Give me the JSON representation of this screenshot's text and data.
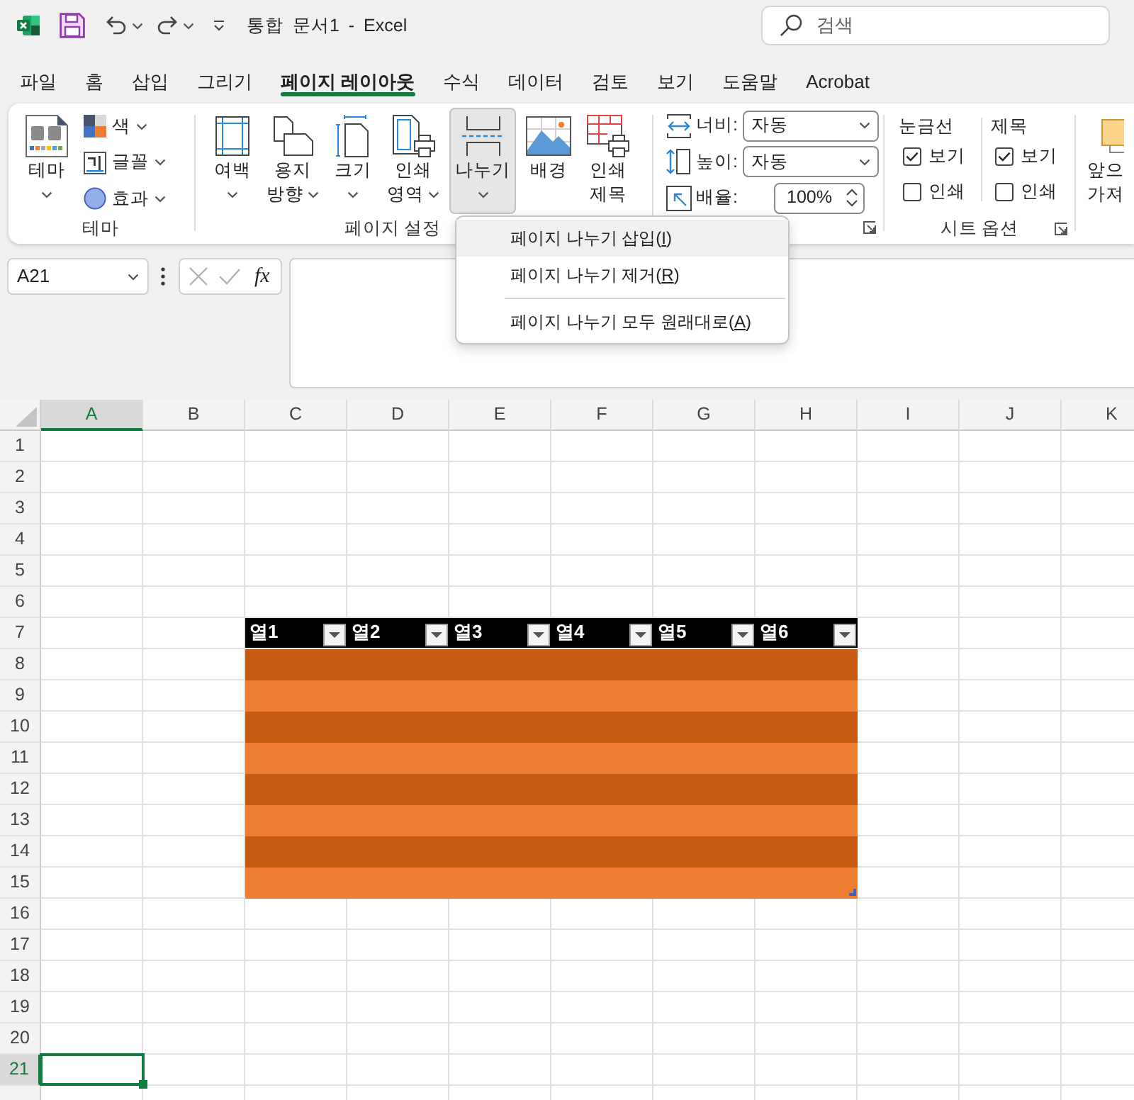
{
  "title_bar": {
    "document_title": "통합 문서1 - Excel",
    "search": {
      "placeholder": "검색"
    }
  },
  "ribbon_tabs": [
    {
      "label": "파일",
      "selected": false
    },
    {
      "label": "홈",
      "selected": false
    },
    {
      "label": "삽입",
      "selected": false
    },
    {
      "label": "그리기",
      "selected": false
    },
    {
      "label": "페이지 레이아웃",
      "selected": true
    },
    {
      "label": "수식",
      "selected": false
    },
    {
      "label": "데이터",
      "selected": false
    },
    {
      "label": "검토",
      "selected": false
    },
    {
      "label": "보기",
      "selected": false
    },
    {
      "label": "도움말",
      "selected": false
    },
    {
      "label": "Acrobat",
      "selected": false
    }
  ],
  "ribbon": {
    "groups": [
      {
        "kind": "themes",
        "label": "테마",
        "dialog_launcher": false,
        "large_buttons": [
          {
            "kind": "theme",
            "label_lines": [
              "테마"
            ],
            "dropdown": true,
            "pressed": false
          }
        ],
        "small_buttons": [
          {
            "kind": "colors",
            "label": "색",
            "dropdown": true
          },
          {
            "kind": "fonts",
            "label": "글꼴",
            "dropdown": true
          },
          {
            "kind": "effects",
            "label": "효과",
            "dropdown": true
          }
        ]
      },
      {
        "kind": "page_setup",
        "label": "페이지 설정",
        "dialog_launcher": false,
        "large_buttons": [
          {
            "kind": "margins",
            "label_lines": [
              "여백"
            ],
            "dropdown": true,
            "pressed": false
          },
          {
            "kind": "orientation",
            "label_lines": [
              "용지",
              "방향"
            ],
            "dropdown": true,
            "pressed": false
          },
          {
            "kind": "size",
            "label_lines": [
              "크기"
            ],
            "dropdown": true,
            "pressed": false
          },
          {
            "kind": "print_area",
            "label_lines": [
              "인쇄",
              "영역"
            ],
            "dropdown": true,
            "pressed": false
          },
          {
            "kind": "breaks",
            "label_lines": [
              "나누기"
            ],
            "dropdown": true,
            "pressed": true
          },
          {
            "kind": "background",
            "label_lines": [
              "배경"
            ],
            "dropdown": false,
            "pressed": false
          },
          {
            "kind": "print_titles",
            "label_lines": [
              "인쇄",
              "제목"
            ],
            "dropdown": false,
            "pressed": false
          }
        ]
      },
      {
        "kind": "scale_to_fit",
        "dialog_launcher": true,
        "fields": [
          {
            "kind": "width",
            "label": "너비:",
            "value": "자동"
          },
          {
            "kind": "height",
            "label": "높이:",
            "value": "자동"
          },
          {
            "kind": "scale",
            "label": "배율:",
            "value": "100%"
          }
        ]
      },
      {
        "kind": "sheet_options",
        "label": "시트 옵션",
        "dialog_launcher": true,
        "option_columns": [
          {
            "heading": "눈금선",
            "options": [
              {
                "label": "보기",
                "checked": true
              },
              {
                "label": "인쇄",
                "checked": false
              }
            ]
          },
          {
            "heading": "제목",
            "options": [
              {
                "label": "보기",
                "checked": true
              },
              {
                "label": "인쇄",
                "checked": false
              }
            ]
          }
        ]
      },
      {
        "kind": "arrange",
        "large_buttons": [
          {
            "kind": "bring_forward",
            "label_lines": [
              "앞으",
              "가져"
            ],
            "dropdown": false,
            "pressed": false
          }
        ]
      }
    ]
  },
  "breaks_menu": {
    "items": [
      {
        "text": "페이지 나누기 삽입(",
        "access_key": "I",
        "text_end": ")",
        "selected": true,
        "divider_above": false
      },
      {
        "text": "페이지 나누기 제거(",
        "access_key": "R",
        "text_end": ")",
        "selected": false,
        "divider_above": false
      },
      {
        "text": "페이지 나누기 모두 원래대로(",
        "access_key": "A",
        "text_end": ")",
        "selected": false,
        "divider_above": true
      }
    ]
  },
  "formula_bar": {
    "name_box": "A21",
    "function_button": "fx"
  },
  "sheet": {
    "columns": [
      {
        "label": "A",
        "selected": true,
        "in_table": false
      },
      {
        "label": "B",
        "selected": false,
        "in_table": false
      },
      {
        "label": "C",
        "selected": false,
        "in_table": true
      },
      {
        "label": "D",
        "selected": false,
        "in_table": true
      },
      {
        "label": "E",
        "selected": false,
        "in_table": true
      },
      {
        "label": "F",
        "selected": false,
        "in_table": true
      },
      {
        "label": "G",
        "selected": false,
        "in_table": true
      },
      {
        "label": "H",
        "selected": false,
        "in_table": true
      },
      {
        "label": "I",
        "selected": false,
        "in_table": false
      },
      {
        "label": "J",
        "selected": false,
        "in_table": false
      },
      {
        "label": "K",
        "selected": false,
        "in_table": false
      }
    ],
    "rows": [
      {
        "label": "1",
        "kind": "plain",
        "selected": false
      },
      {
        "label": "2",
        "kind": "plain",
        "selected": false
      },
      {
        "label": "3",
        "kind": "plain",
        "selected": false
      },
      {
        "label": "4",
        "kind": "plain",
        "selected": false
      },
      {
        "label": "5",
        "kind": "plain",
        "selected": false
      },
      {
        "label": "6",
        "kind": "plain",
        "selected": false
      },
      {
        "label": "7",
        "kind": "table_header",
        "selected": false
      },
      {
        "label": "8",
        "kind": "band_dark",
        "selected": false
      },
      {
        "label": "9",
        "kind": "band_light",
        "selected": false
      },
      {
        "label": "10",
        "kind": "band_dark",
        "selected": false
      },
      {
        "label": "11",
        "kind": "band_light",
        "selected": false
      },
      {
        "label": "12",
        "kind": "band_dark",
        "selected": false
      },
      {
        "label": "13",
        "kind": "band_light",
        "selected": false
      },
      {
        "label": "14",
        "kind": "band_dark",
        "selected": false
      },
      {
        "label": "15",
        "kind": "band_light",
        "selected": false
      },
      {
        "label": "16",
        "kind": "plain",
        "selected": false
      },
      {
        "label": "17",
        "kind": "plain",
        "selected": false
      },
      {
        "label": "18",
        "kind": "plain",
        "selected": false
      },
      {
        "label": "19",
        "kind": "plain",
        "selected": false
      },
      {
        "label": "20",
        "kind": "plain",
        "selected": false
      },
      {
        "label": "21",
        "kind": "plain",
        "selected": true
      }
    ],
    "table": {
      "headers": [
        "열1",
        "열2",
        "열3",
        "열4",
        "열5",
        "열6"
      ]
    }
  }
}
